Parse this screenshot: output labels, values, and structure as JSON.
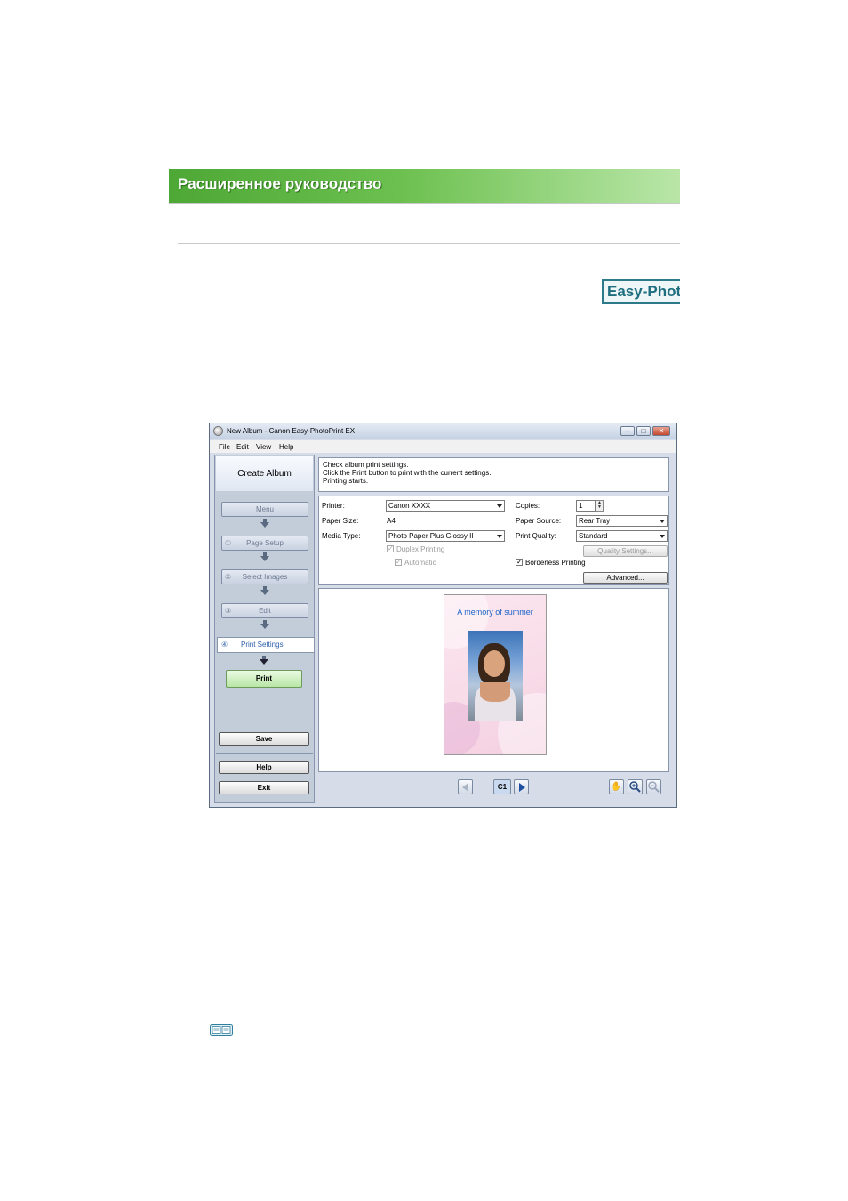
{
  "header": {
    "title": "Расширенное руководство",
    "logo_text": "Easy-PhotoPrint EX"
  },
  "window": {
    "title": "New Album - Canon Easy-PhotoPrint EX",
    "menu": [
      "File",
      "Edit",
      "View",
      "Help"
    ],
    "left_panel": {
      "heading": "Create Album",
      "steps": [
        {
          "num": "",
          "label": "Menu"
        },
        {
          "num": "①",
          "label": "Page Setup"
        },
        {
          "num": "②",
          "label": "Select Images"
        },
        {
          "num": "③",
          "label": "Edit"
        }
      ],
      "active_step": {
        "num": "④",
        "label": "Print Settings"
      },
      "print_label": "Print",
      "save_label": "Save",
      "help_label": "Help",
      "exit_label": "Exit"
    },
    "instructions": [
      "Check album print settings.",
      "Click the Print button to print with the current settings.",
      "Printing starts."
    ],
    "settings": {
      "printer_label": "Printer:",
      "printer_value": "Canon XXXX",
      "paper_size_label": "Paper Size:",
      "paper_size_value": "A4",
      "media_type_label": "Media Type:",
      "media_type_value": "Photo Paper Plus Glossy II",
      "duplex_label": "Duplex Printing",
      "automatic_label": "Automatic",
      "copies_label": "Copies:",
      "copies_value": "1",
      "paper_source_label": "Paper Source:",
      "paper_source_value": "Rear Tray",
      "print_quality_label": "Print Quality:",
      "print_quality_value": "Standard",
      "quality_settings_label": "Quality Settings...",
      "borderless_label": "Borderless Printing",
      "advanced_label": "Advanced..."
    },
    "preview": {
      "caption": "A memory of summer",
      "page_indicator": "C1"
    }
  },
  "colors": {
    "banner_green": "#4ea835",
    "print_button": "#b8e6a5",
    "caption_blue": "#1e64c8"
  }
}
